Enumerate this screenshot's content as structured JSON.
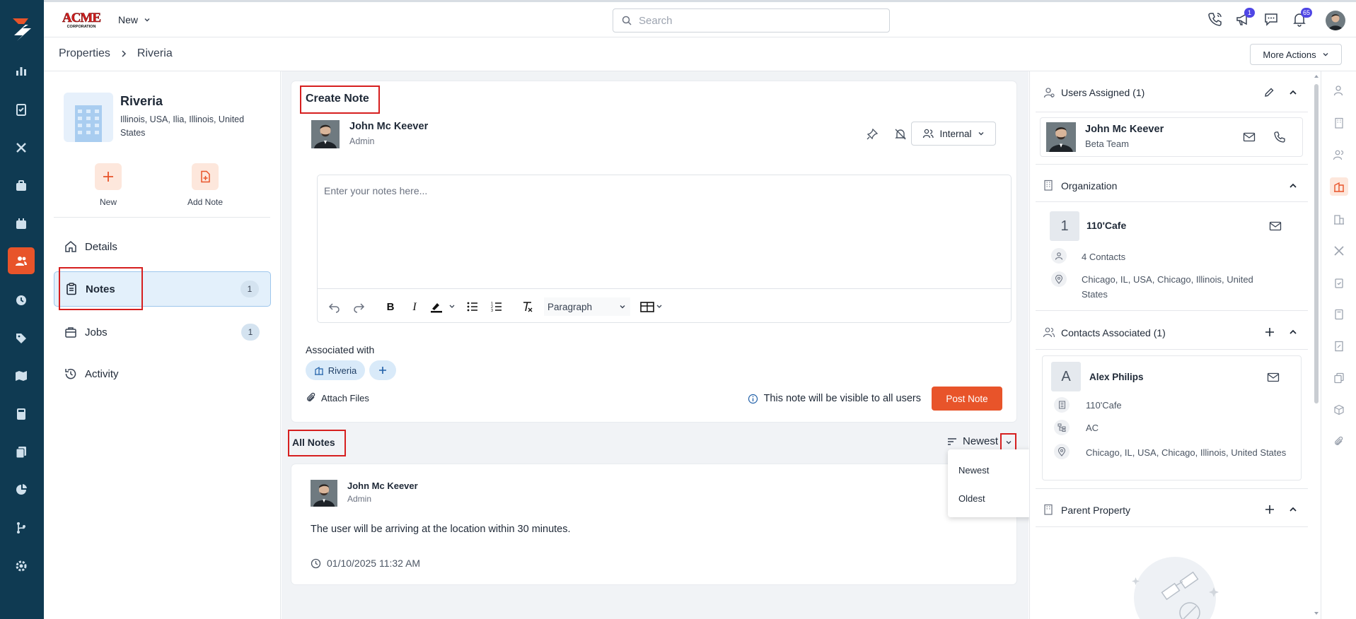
{
  "brand": {
    "logo_text": "ACME",
    "logo_sub": "CORPORATION"
  },
  "topbar": {
    "new_label": "New",
    "search_placeholder": "Search",
    "icons": [
      "phone-icon",
      "megaphone-icon",
      "chat-icon",
      "bell-icon"
    ],
    "megaphone_badge": "1",
    "bell_badge": "65"
  },
  "breadcrumb": {
    "root": "Properties",
    "current": "Riveria"
  },
  "more_actions_label": "More Actions",
  "property": {
    "name": "Riveria",
    "address": "Illinois, USA, Ilia, Illinois, United States"
  },
  "quick_actions": {
    "new_label": "New",
    "add_note_label": "Add Note"
  },
  "left_nav": [
    {
      "label": "Details",
      "icon": "home-icon",
      "count": ""
    },
    {
      "label": "Notes",
      "icon": "clipboard-icon",
      "count": "1"
    },
    {
      "label": "Jobs",
      "icon": "briefcase-icon",
      "count": "1"
    },
    {
      "label": "Activity",
      "icon": "history-icon",
      "count": ""
    }
  ],
  "create_note": {
    "title": "Create Note",
    "author_name": "John Mc Keever",
    "author_role": "Admin",
    "visibility_label": "Internal",
    "editor_placeholder": "Enter your notes here...",
    "paragraph_label": "Paragraph",
    "associated_label": "Associated with",
    "associated_chip": "Riveria",
    "attach_label": "Attach Files",
    "visibility_note": "This note will be visible to all users",
    "post_label": "Post Note"
  },
  "all_notes": {
    "title": "All Notes",
    "sort_label": "Newest",
    "sort_options": [
      "Newest",
      "Oldest"
    ],
    "notes": [
      {
        "author_name": "John Mc Keever",
        "author_role": "Admin",
        "body": "The user will be arriving at the location within 30 minutes.",
        "timestamp": "01/10/2025 11:32 AM"
      }
    ]
  },
  "right_panel": {
    "users_assigned_title": "Users Assigned (1)",
    "user": {
      "name": "John Mc Keever",
      "team": "Beta Team"
    },
    "organization_title": "Organization",
    "org": {
      "initial": "1",
      "name": "110'Cafe",
      "contacts": "4 Contacts",
      "address": "Chicago, IL, USA, Chicago, Illinois, United States"
    },
    "contacts_title": "Contacts Associated (1)",
    "contact": {
      "initial": "A",
      "name": "Alex Philips",
      "company": "110'Cafe",
      "code": "AC",
      "address": "Chicago, IL, USA, Chicago, Illinois, United States"
    },
    "parent_property_title": "Parent Property"
  },
  "colors": {
    "rail": "#0f3a52",
    "accent": "#e8542a",
    "highlight": "#d61f1f",
    "active_nav": "#e3f0fb"
  }
}
